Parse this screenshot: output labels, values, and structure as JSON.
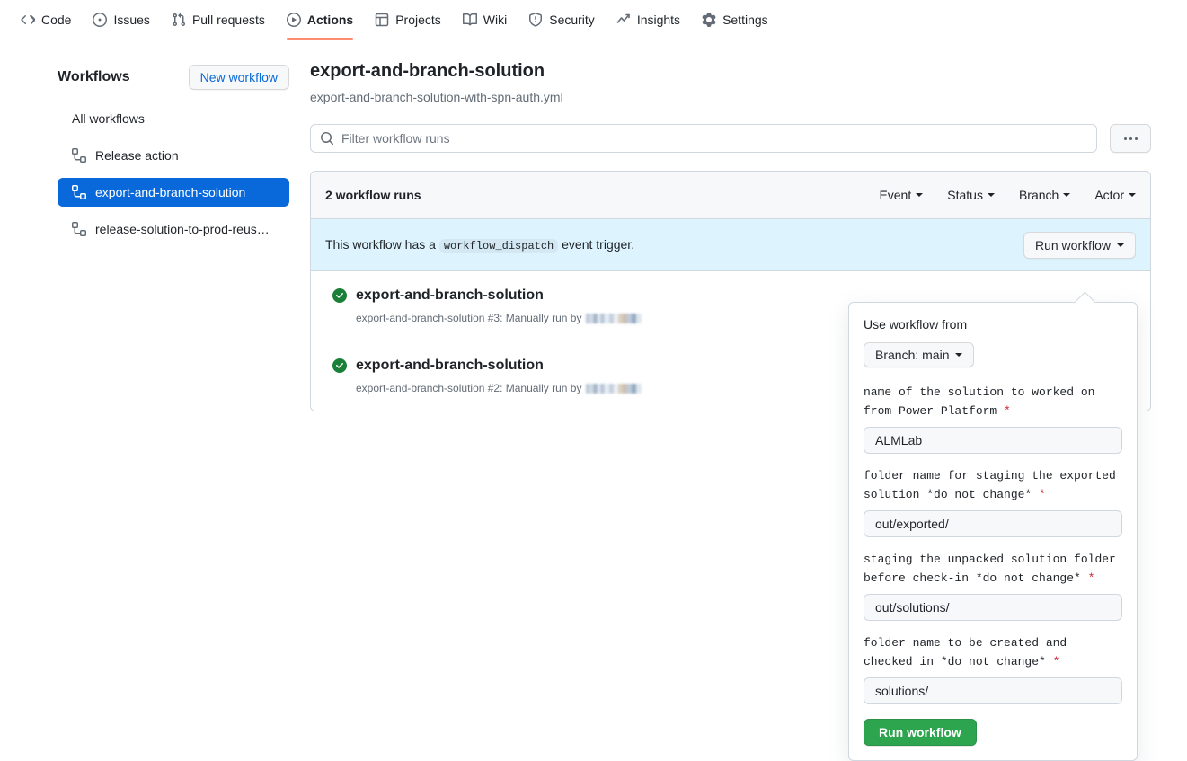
{
  "repo_nav": {
    "items": [
      {
        "label": "Code",
        "icon": "code-icon",
        "active": false
      },
      {
        "label": "Issues",
        "icon": "issue-opened-icon",
        "active": false
      },
      {
        "label": "Pull requests",
        "icon": "git-pull-request-icon",
        "active": false
      },
      {
        "label": "Actions",
        "icon": "play-circle-icon",
        "active": true
      },
      {
        "label": "Projects",
        "icon": "table-icon",
        "active": false
      },
      {
        "label": "Wiki",
        "icon": "book-icon",
        "active": false
      },
      {
        "label": "Security",
        "icon": "shield-icon",
        "active": false
      },
      {
        "label": "Insights",
        "icon": "graph-icon",
        "active": false
      },
      {
        "label": "Settings",
        "icon": "gear-icon",
        "active": false
      }
    ],
    "active_accent": "#fd8c73"
  },
  "sidebar": {
    "title": "Workflows",
    "new_workflow_label": "New workflow",
    "items": [
      {
        "label": "All workflows",
        "icon": "none",
        "selected": false
      },
      {
        "label": "Release action",
        "icon": "workflow-icon",
        "selected": false
      },
      {
        "label": "export-and-branch-solution",
        "icon": "workflow-icon",
        "selected": true
      },
      {
        "label": "release-solution-to-prod-reus…",
        "icon": "workflow-icon",
        "selected": false
      }
    ],
    "selected_color": "#0969da"
  },
  "main": {
    "workflow_title": "export-and-branch-solution",
    "workflow_file": "export-and-branch-solution-with-spn-auth.yml",
    "search_placeholder": "Filter workflow runs",
    "search_value": "",
    "kebab_label": "More options"
  },
  "runs_panel": {
    "count_label": "2 workflow runs",
    "filters": [
      {
        "label": "Event"
      },
      {
        "label": "Status"
      },
      {
        "label": "Branch"
      },
      {
        "label": "Actor"
      }
    ],
    "banner": {
      "text_before": "This workflow has a",
      "code": "workflow_dispatch",
      "text_after": "event trigger.",
      "button_label": "Run workflow",
      "background": "#ddf4ff"
    },
    "runs": [
      {
        "title": "export-and-branch-solution",
        "subtitle": "export-and-branch-solution #3: Manually run by",
        "actor": "",
        "status": "success",
        "status_color": "#1a7f37"
      },
      {
        "title": "export-and-branch-solution",
        "subtitle": "export-and-branch-solution #2: Manually run by",
        "actor": "",
        "status": "success",
        "status_color": "#1a7f37"
      }
    ]
  },
  "run_dropdown": {
    "use_workflow_from": "Use workflow from",
    "branch_label": "Branch: main",
    "fields": [
      {
        "label": "name of the solution to worked on from Power Platform",
        "required": true,
        "value": "ALMLab"
      },
      {
        "label": "folder name for staging the exported solution *do not change*",
        "required": true,
        "value": "out/exported/"
      },
      {
        "label": "staging the unpacked solution folder before check-in *do not change*",
        "required": true,
        "value": "out/solutions/"
      },
      {
        "label": "folder name to be created and checked in *do not change*",
        "required": true,
        "value": "solutions/"
      }
    ],
    "submit_label": "Run workflow",
    "submit_color": "#2da44e"
  }
}
